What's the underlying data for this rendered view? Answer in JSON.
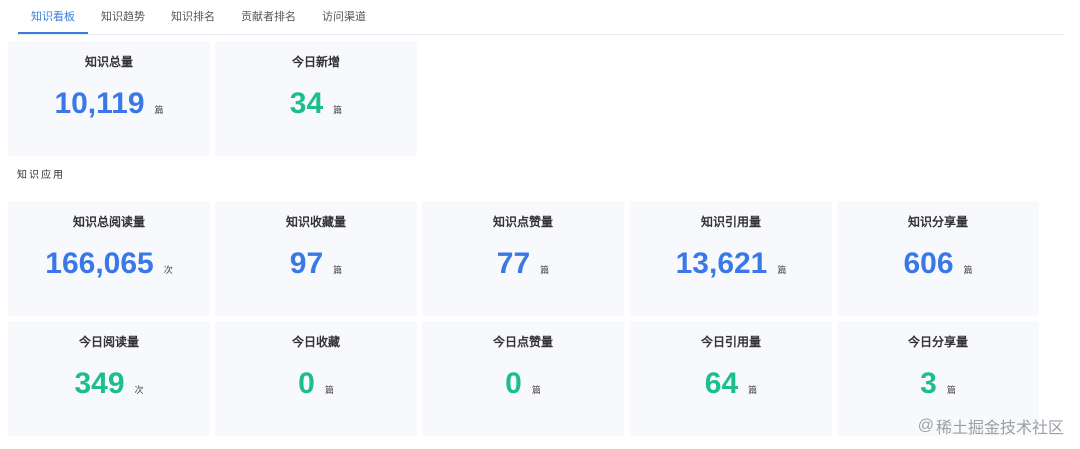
{
  "tabs": [
    {
      "label": "知识看板",
      "active": true
    },
    {
      "label": "知识趋势",
      "active": false
    },
    {
      "label": "知识排名",
      "active": false
    },
    {
      "label": "贡献者排名",
      "active": false
    },
    {
      "label": "访问渠道",
      "active": false
    }
  ],
  "overview": {
    "total": {
      "title": "知识总量",
      "value": "10,119",
      "unit": "篇"
    },
    "today_new": {
      "title": "今日新增",
      "value": "34",
      "unit": "篇"
    }
  },
  "section": {
    "title": "知识应用"
  },
  "totals_row": [
    {
      "title": "知识总阅读量",
      "value": "166,065",
      "unit": "次"
    },
    {
      "title": "知识收藏量",
      "value": "97",
      "unit": "篇"
    },
    {
      "title": "知识点赞量",
      "value": "77",
      "unit": "篇"
    },
    {
      "title": "知识引用量",
      "value": "13,621",
      "unit": "篇"
    },
    {
      "title": "知识分享量",
      "value": "606",
      "unit": "篇"
    }
  ],
  "today_row": [
    {
      "title": "今日阅读量",
      "value": "349",
      "unit": "次"
    },
    {
      "title": "今日收藏",
      "value": "0",
      "unit": "篇"
    },
    {
      "title": "今日点赞量",
      "value": "0",
      "unit": "篇"
    },
    {
      "title": "今日引用量",
      "value": "64",
      "unit": "篇"
    },
    {
      "title": "今日分享量",
      "value": "3",
      "unit": "篇"
    }
  ],
  "watermark": {
    "at": "@",
    "text": "稀土掘金技术社区"
  },
  "colors": {
    "accent_blue": "#3a78e6",
    "accent_green": "#1cbf8a",
    "tab_active": "#3b7ddd",
    "card_bg": "#f8f9fc"
  }
}
